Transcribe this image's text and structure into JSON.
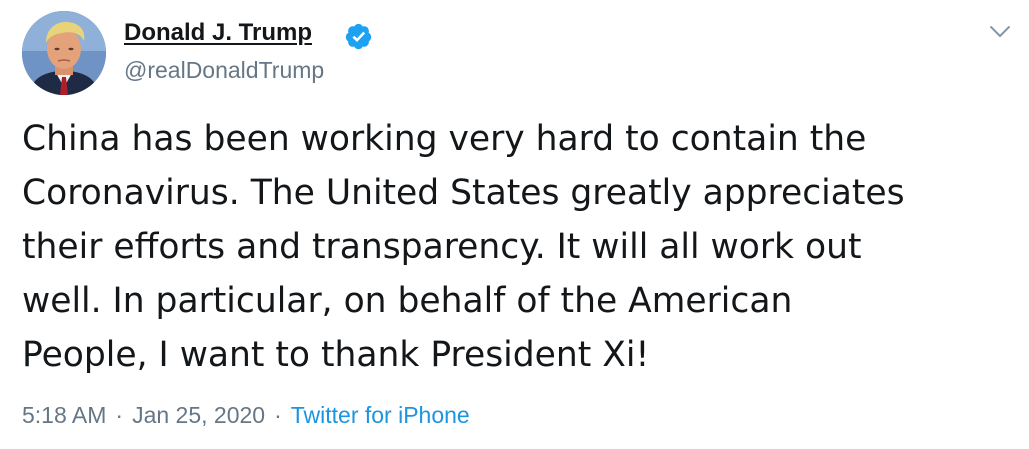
{
  "author": {
    "display_name": "Donald J. Trump",
    "handle": "@realDonaldTrump",
    "verified": true,
    "avatar_icon": "profile-photo"
  },
  "tweet": {
    "text_lines": [
      "China has been working very hard to contain the",
      "Coronavirus. The United States greatly appreciates",
      "their efforts and transparency. It will all work out",
      "well. In particular, on behalf of the American",
      "People, I want to thank President Xi!"
    ]
  },
  "meta": {
    "time": "5:18 AM",
    "separator": "·",
    "date": "Jan 25, 2020",
    "source": "Twitter for iPhone"
  },
  "icons": {
    "verified": "verified-badge-icon",
    "menu": "chevron-down-icon"
  },
  "colors": {
    "primary_text": "#14171a",
    "secondary_text": "#657786",
    "link": "#1b95e0",
    "verified_badge": "#1da1f2",
    "background": "#ffffff"
  }
}
